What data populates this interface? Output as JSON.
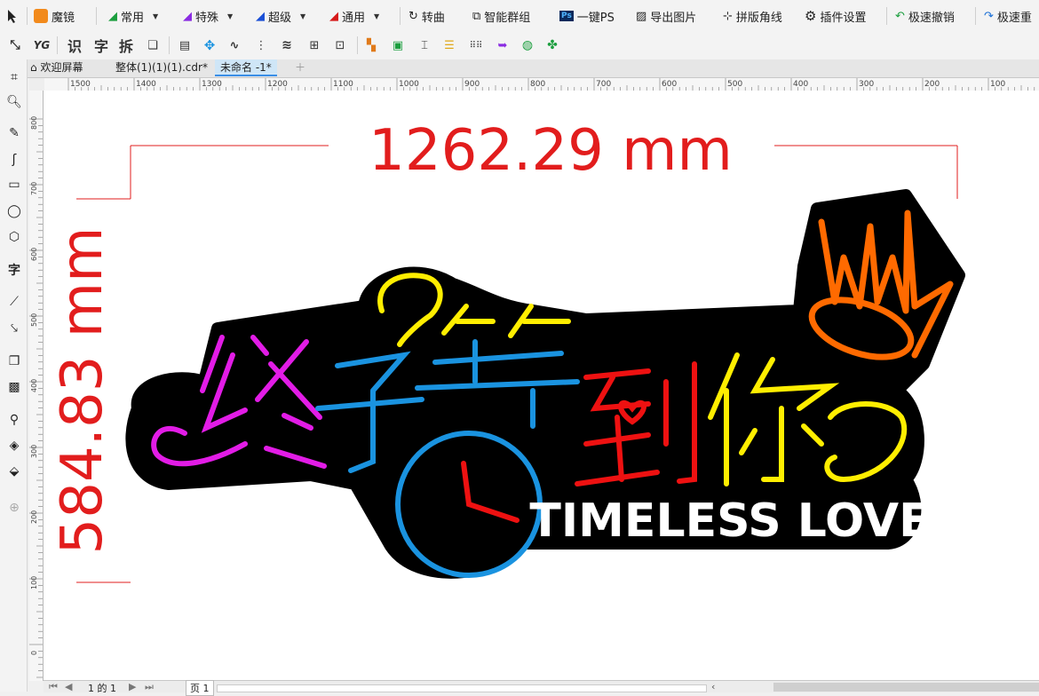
{
  "toolbar_top": {
    "brand_label": "魔镜",
    "menus": [
      {
        "label": "常用",
        "icon": "brush-icon"
      },
      {
        "label": "特殊",
        "icon": "brush-icon"
      },
      {
        "label": "超级",
        "icon": "brush-icon"
      },
      {
        "label": "通用",
        "icon": "brush-icon"
      }
    ],
    "buttons": [
      {
        "label": "转曲",
        "icon": "curve-convert-icon"
      },
      {
        "label": "智能群组",
        "icon": "group-icon"
      },
      {
        "label": "一键PS",
        "icon": "ps-icon"
      },
      {
        "label": "导出图片",
        "icon": "image-export-icon"
      },
      {
        "label": "拼版角线",
        "icon": "crop-mark-icon"
      },
      {
        "label": "插件设置",
        "icon": "gear-icon"
      },
      {
        "label": "极速撤销",
        "icon": "undo-icon"
      },
      {
        "label": "极速重",
        "icon": "redo-icon"
      }
    ]
  },
  "toolbar_second": {
    "text_tools": [
      "识",
      "字",
      "拆"
    ]
  },
  "tabs": [
    {
      "label": "欢迎屏幕"
    },
    {
      "label": "整体(1)(1)(1).cdr*"
    },
    {
      "label": "未命名 -1*"
    }
  ],
  "ruler_h": [
    "1500",
    "1400",
    "1300",
    "1200",
    "1100",
    "1000",
    "900",
    "800",
    "700",
    "600",
    "500",
    "400",
    "300",
    "200",
    "100"
  ],
  "ruler_v": [
    "800",
    "700",
    "600",
    "500",
    "400",
    "300",
    "200",
    "100",
    "0"
  ],
  "design": {
    "width_dim": "1262.29 mm",
    "height_dim": "584.83 mm",
    "chinese_chars": [
      "终",
      "于",
      "等",
      "到",
      "你"
    ],
    "subtitle": "TIMELESS LOVE",
    "colors": {
      "dimension": "#e21d1d",
      "magenta": "#e21ce6",
      "blue": "#1a93e0",
      "yellow": "#ffee00",
      "red": "#ee1111",
      "orange": "#ff6a00",
      "background": "#000000",
      "white": "#ffffff"
    }
  },
  "status": {
    "page_info": "1 的 1",
    "page_tab": "页 1"
  }
}
